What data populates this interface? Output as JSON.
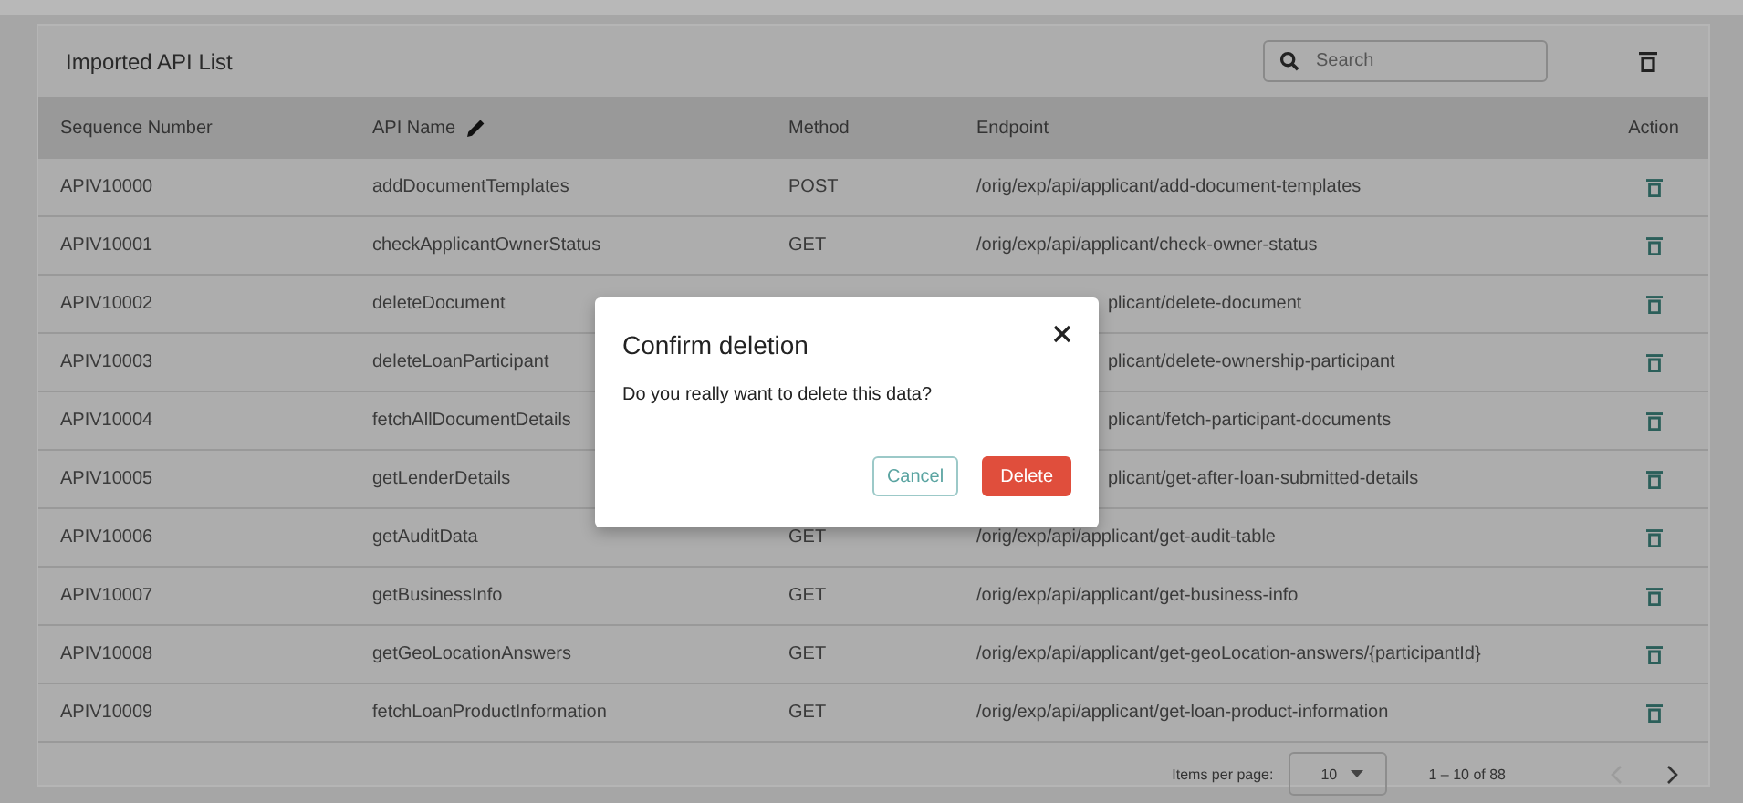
{
  "panel": {
    "title": "Imported API List",
    "search": {
      "placeholder": "Search"
    }
  },
  "table": {
    "columns": [
      {
        "label": "Sequence Number",
        "kind": "plain"
      },
      {
        "label": "API Name",
        "kind": "editable"
      },
      {
        "label": "Method",
        "kind": "plain"
      },
      {
        "label": "Endpoint",
        "kind": "plain"
      },
      {
        "label": "Action",
        "kind": "action"
      }
    ],
    "rows": [
      {
        "kind": "full",
        "sequence": "APIV10000",
        "api_name": "addDocumentTemplates",
        "method": "POST",
        "endpoint": "/orig/exp/api/applicant/add-document-templates"
      },
      {
        "kind": "full",
        "sequence": "APIV10001",
        "api_name": "checkApplicantOwnerStatus",
        "method": "GET",
        "endpoint": "/orig/exp/api/applicant/check-owner-status"
      },
      {
        "kind": "covered",
        "sequence": "APIV10002",
        "api_name": "deleteDocument",
        "endpoint": "plicant/delete-document"
      },
      {
        "kind": "covered",
        "sequence": "APIV10003",
        "api_name": "deleteLoanParticipant",
        "endpoint": "plicant/delete-ownership-participant"
      },
      {
        "kind": "covered",
        "sequence": "APIV10004",
        "api_name": "fetchAllDocumentDetails",
        "endpoint": "plicant/fetch-participant-documents"
      },
      {
        "kind": "covered",
        "sequence": "APIV10005",
        "api_name": "getLenderDetails",
        "endpoint": "plicant/get-after-loan-submitted-details"
      },
      {
        "kind": "full",
        "sequence": "APIV10006",
        "api_name": "getAuditData",
        "method": "GET",
        "endpoint": "/orig/exp/api/applicant/get-audit-table"
      },
      {
        "kind": "full",
        "sequence": "APIV10007",
        "api_name": "getBusinessInfo",
        "method": "GET",
        "endpoint": "/orig/exp/api/applicant/get-business-info"
      },
      {
        "kind": "full",
        "sequence": "APIV10008",
        "api_name": "getGeoLocationAnswers",
        "method": "GET",
        "endpoint": "/orig/exp/api/applicant/get-geoLocation-answers/{participantId}"
      },
      {
        "kind": "full",
        "sequence": "APIV10009",
        "api_name": "fetchLoanProductInformation",
        "method": "GET",
        "endpoint": "/orig/exp/api/applicant/get-loan-product-information"
      }
    ]
  },
  "pagination": {
    "label": "Items per page:",
    "page_size": "10",
    "range": "1 – 10 of 88",
    "previous_disabled": true
  },
  "dialog": {
    "title": "Confirm deletion",
    "message": "Do you really want to delete this data?",
    "buttons": [
      "Cancel",
      "Delete"
    ]
  }
}
